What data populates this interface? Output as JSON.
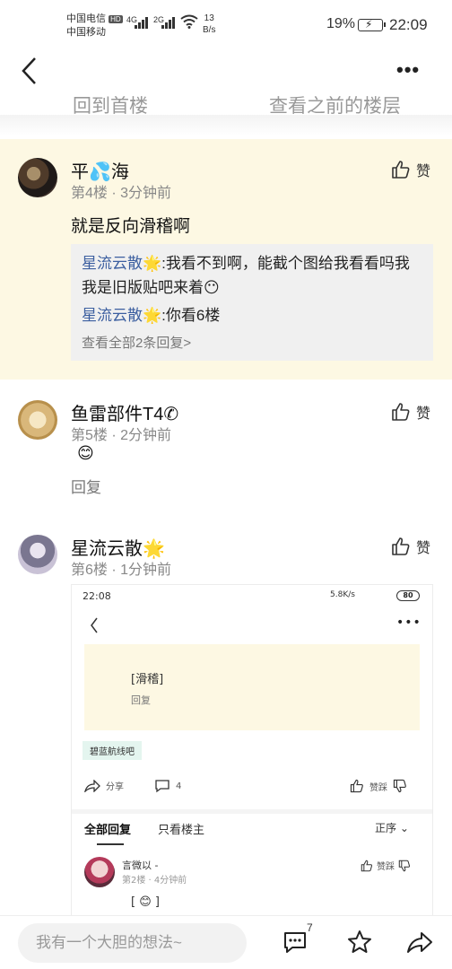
{
  "status_bar": {
    "carrier_1": "中国电信",
    "carrier_1_tag": "HD",
    "carrier_2": "中国移动",
    "signal_1": "4G",
    "signal_2": "2G",
    "net_speed_value": "13",
    "net_speed_unit": "B/s",
    "battery": "19%",
    "time": "22:09"
  },
  "jump_bar": {
    "back_to_top": "回到首楼",
    "view_previous": "查看之前的楼层"
  },
  "posts": [
    {
      "username": "平💦海",
      "meta": "第4楼 · 3分钟前",
      "like_label": "赞",
      "content": "就是反向滑稽啊",
      "sub_replies": [
        {
          "user": "星流云散🌟",
          "text": ":我看不到啊，能截个图给我看看吗我我是旧版贴吧来着😶"
        },
        {
          "user": "星流云散🌟",
          "text": ":你看6楼"
        }
      ],
      "view_all": "查看全部2条回复>"
    },
    {
      "username": "鱼雷部件T4✆",
      "meta": "第5楼 · 2分钟前",
      "like_label": "赞",
      "content": "😊",
      "reply_label": "回复"
    },
    {
      "username": "星流云散🌟",
      "meta": "第6楼 · 1分钟前",
      "like_label": "赞"
    }
  ],
  "embedded_screenshot": {
    "time": "22:08",
    "speed": "5.8K/s",
    "battery": "80",
    "card_text": "[滑稽]",
    "card_reply": "回复",
    "tag": "碧蓝航线吧",
    "share": "分享",
    "comment_count": "4",
    "like": "赞踩",
    "tab_all": "全部回复",
    "tab_op": "只看楼主",
    "sort": "正序",
    "reply_user": "言微以 -",
    "reply_meta": "第2楼 · 4分钟前",
    "reply_like": "赞踩",
    "reply_content": "[ 😊 ]"
  },
  "bottom_bar": {
    "placeholder": "我有一个大胆的想法~",
    "comment_badge": "7"
  },
  "colors": {
    "highlight_bg": "#fdf8e3",
    "link_blue": "#3c5fa0",
    "muted": "#888888"
  }
}
